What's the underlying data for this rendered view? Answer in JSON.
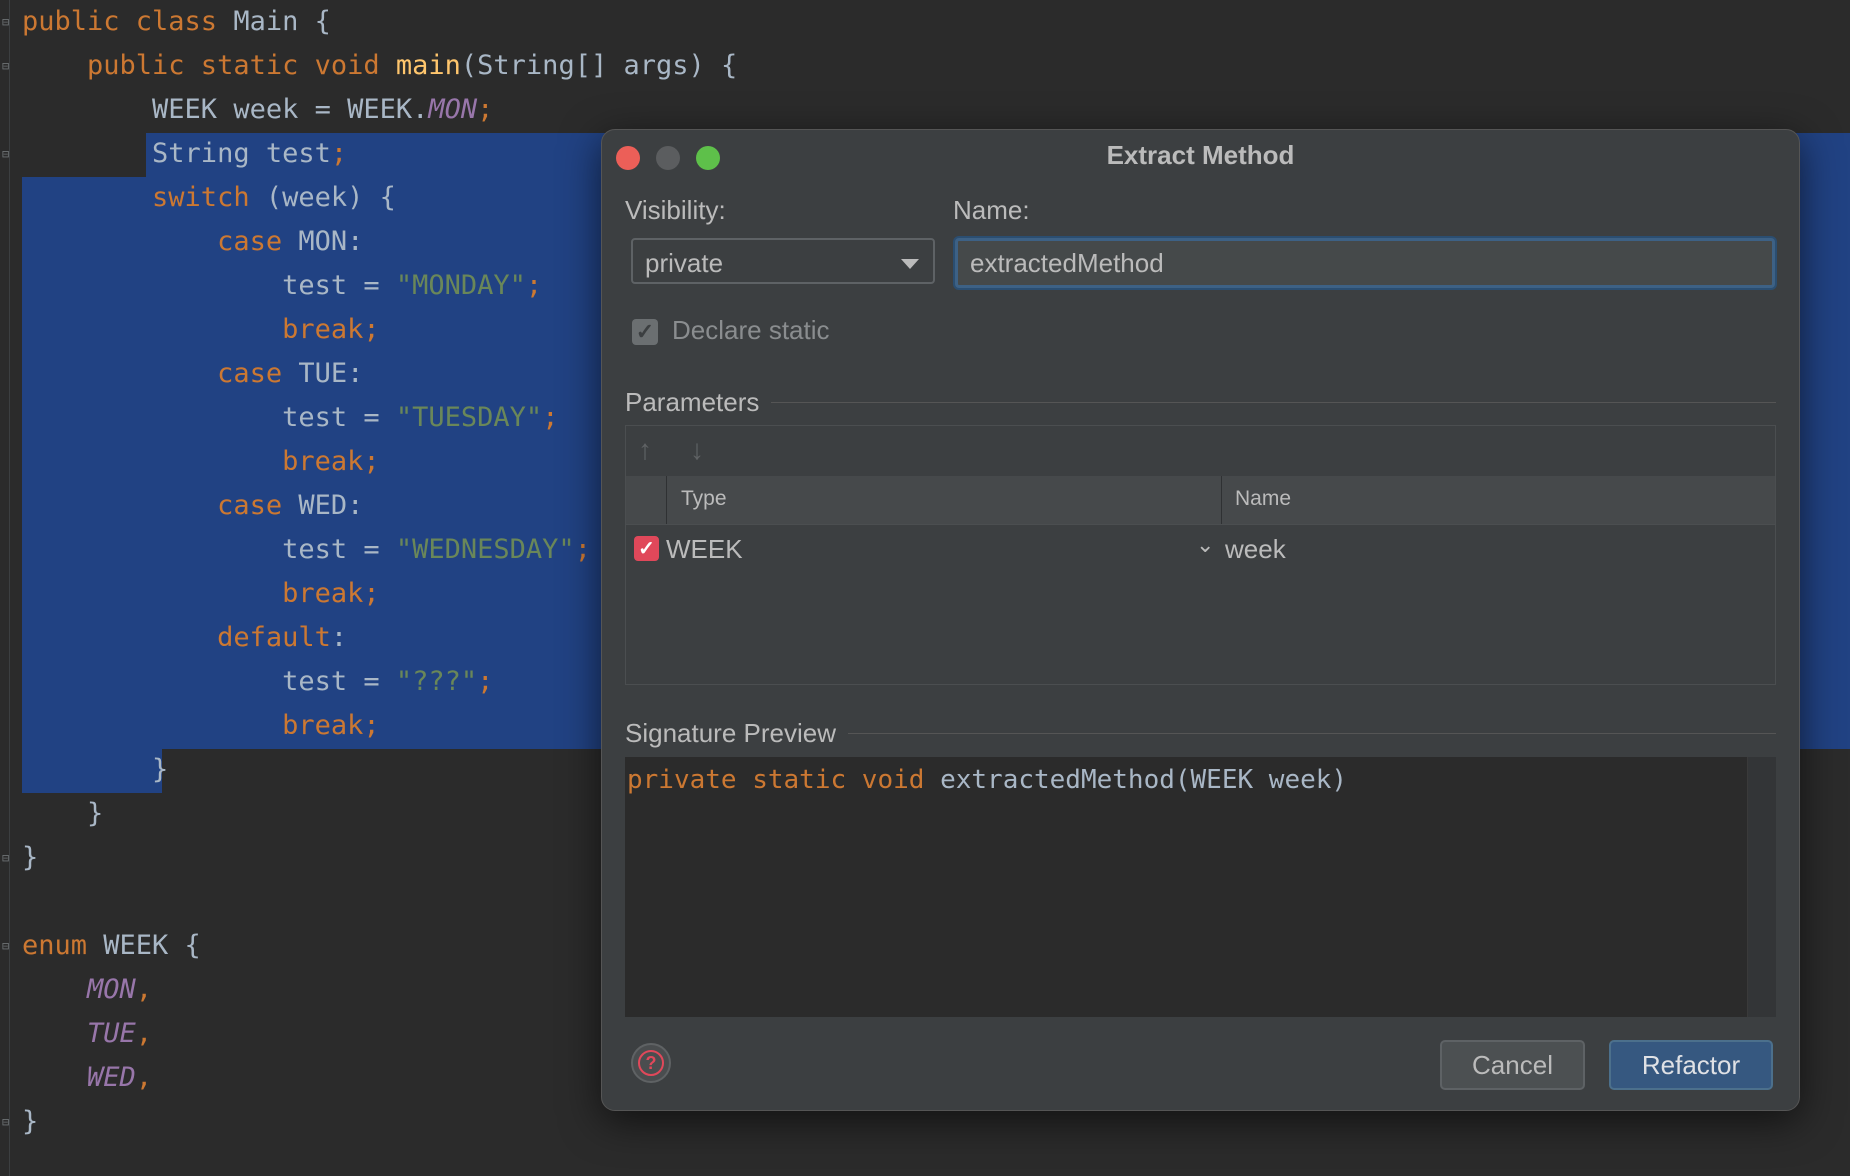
{
  "editor": {
    "lines": [
      {
        "parts": [
          {
            "t": "public class ",
            "c": "kw"
          },
          {
            "t": "Main {",
            "c": ""
          }
        ]
      },
      {
        "parts": [
          {
            "t": "    public static void ",
            "c": "kw"
          },
          {
            "t": "main",
            "c": "fn"
          },
          {
            "t": "(String[] args) {",
            "c": ""
          }
        ]
      },
      {
        "parts": [
          {
            "t": "        WEEK week = WEEK.",
            "c": ""
          },
          {
            "t": "MON",
            "c": "konst"
          },
          {
            "t": ";",
            "c": "kw"
          }
        ]
      },
      {
        "parts": [
          {
            "t": "        String test",
            "c": ""
          },
          {
            "t": ";",
            "c": "kw"
          }
        ]
      },
      {
        "parts": [
          {
            "t": "        switch ",
            "c": "kw"
          },
          {
            "t": "(week) {",
            "c": ""
          }
        ]
      },
      {
        "parts": [
          {
            "t": "            case ",
            "c": "kw"
          },
          {
            "t": "MON:",
            "c": ""
          }
        ]
      },
      {
        "parts": [
          {
            "t": "                test = ",
            "c": ""
          },
          {
            "t": "\"MONDAY\"",
            "c": "str"
          },
          {
            "t": ";",
            "c": "kw"
          }
        ]
      },
      {
        "parts": [
          {
            "t": "                break;",
            "c": "kw"
          }
        ]
      },
      {
        "parts": [
          {
            "t": "            case ",
            "c": "kw"
          },
          {
            "t": "TUE:",
            "c": ""
          }
        ]
      },
      {
        "parts": [
          {
            "t": "                test = ",
            "c": ""
          },
          {
            "t": "\"TUESDAY\"",
            "c": "str"
          },
          {
            "t": ";",
            "c": "kw"
          }
        ]
      },
      {
        "parts": [
          {
            "t": "                break;",
            "c": "kw"
          }
        ]
      },
      {
        "parts": [
          {
            "t": "            case ",
            "c": "kw"
          },
          {
            "t": "WED:",
            "c": ""
          }
        ]
      },
      {
        "parts": [
          {
            "t": "                test = ",
            "c": ""
          },
          {
            "t": "\"WEDNESDAY\"",
            "c": "str"
          },
          {
            "t": ";",
            "c": "kw"
          }
        ]
      },
      {
        "parts": [
          {
            "t": "                break;",
            "c": "kw"
          }
        ]
      },
      {
        "parts": [
          {
            "t": "            default",
            "c": "kw"
          },
          {
            "t": ":",
            "c": ""
          }
        ]
      },
      {
        "parts": [
          {
            "t": "                test = ",
            "c": ""
          },
          {
            "t": "\"???\"",
            "c": "str"
          },
          {
            "t": ";",
            "c": "kw"
          }
        ]
      },
      {
        "parts": [
          {
            "t": "                break;",
            "c": "kw"
          }
        ]
      },
      {
        "parts": [
          {
            "t": "        }",
            "c": ""
          }
        ]
      },
      {
        "parts": [
          {
            "t": "    }",
            "c": ""
          }
        ]
      },
      {
        "parts": [
          {
            "t": "}",
            "c": ""
          }
        ]
      },
      {
        "parts": [
          {
            "t": "",
            "c": ""
          }
        ]
      },
      {
        "parts": [
          {
            "t": "enum ",
            "c": "kw"
          },
          {
            "t": "WEEK {",
            "c": ""
          }
        ]
      },
      {
        "parts": [
          {
            "t": "    ",
            "c": ""
          },
          {
            "t": "MON",
            "c": "konst"
          },
          {
            "t": ",",
            "c": "kw"
          }
        ]
      },
      {
        "parts": [
          {
            "t": "    ",
            "c": ""
          },
          {
            "t": "TUE",
            "c": "konst"
          },
          {
            "t": ",",
            "c": "kw"
          }
        ]
      },
      {
        "parts": [
          {
            "t": "    ",
            "c": ""
          },
          {
            "t": "WED",
            "c": "konst"
          },
          {
            "t": ",",
            "c": "kw"
          }
        ]
      },
      {
        "parts": [
          {
            "t": "}",
            "c": ""
          }
        ]
      }
    ]
  },
  "dialog": {
    "title": "Extract Method",
    "visibility_label": "Visibility:",
    "visibility_value": "private",
    "name_label": "Name:",
    "name_value": "extractedMethod",
    "declare_static_label": "Declare static",
    "parameters_title": "Parameters",
    "columns": {
      "type": "Type",
      "name": "Name"
    },
    "params": [
      {
        "type": "WEEK",
        "name": "week",
        "checked": true
      }
    ],
    "signature_title": "Signature Preview",
    "signature": {
      "keywords": "private static void ",
      "rest": "extractedMethod(WEEK week)"
    },
    "cancel_label": "Cancel",
    "refactor_label": "Refactor",
    "help_glyph": "?",
    "check_glyph": "✓",
    "up_glyph": "↑",
    "down_glyph": "↓",
    "chevron_glyph": "⌄"
  },
  "colors": {
    "selection": "#214283",
    "keyword": "#cc7832",
    "string": "#6a8759",
    "function": "#ffc66d",
    "constant": "#9876aa",
    "accent_button": "#365880",
    "checkbox_checked": "#e0485a"
  }
}
